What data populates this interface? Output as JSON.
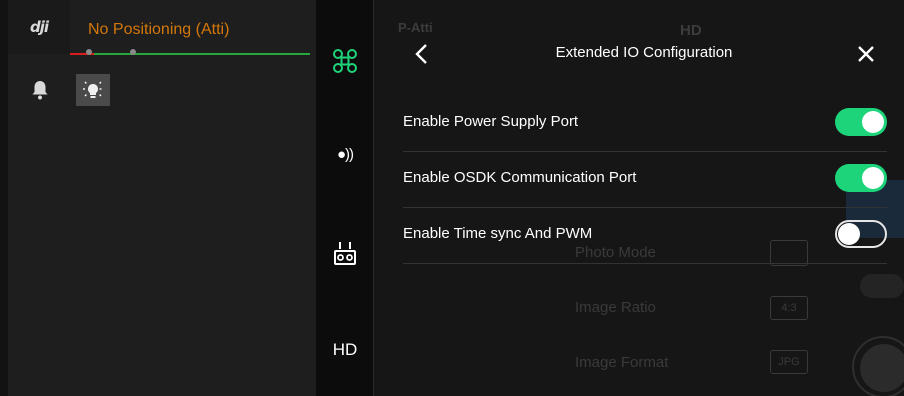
{
  "status": {
    "logo": "dji",
    "flight_mode": "No Positioning (Atti)",
    "colors": {
      "mode_text": "#d4770a",
      "line_red": "#d91e1e",
      "line_green": "#26a83b"
    }
  },
  "left_icons": [
    {
      "name": "bell-icon"
    },
    {
      "name": "auxiliary-light-icon"
    }
  ],
  "sidebar": {
    "items": [
      {
        "name": "aircraft-icon",
        "active": true
      },
      {
        "name": "signal-icon",
        "label": "●))"
      },
      {
        "name": "remote-controller-icon"
      },
      {
        "name": "hd-label",
        "label": "HD"
      }
    ],
    "colors": {
      "active": "#1ed47a"
    }
  },
  "panel": {
    "title": "Extended IO Configuration",
    "rows": [
      {
        "label": "Enable Power Supply Port",
        "enabled": true
      },
      {
        "label": "Enable OSDK Communication Port",
        "enabled": true
      },
      {
        "label": "Enable Time sync And PWM",
        "enabled": false
      }
    ],
    "colors": {
      "toggle_on": "#1ed47a"
    }
  },
  "background": {
    "top_bar": {
      "mode": "P-Atti",
      "hd": "HD"
    },
    "camera_settings": [
      {
        "label": "Photo Mode",
        "value": ""
      },
      {
        "label": "Image Ratio",
        "value": "4:3"
      },
      {
        "label": "Image Format",
        "value": "JPG"
      }
    ]
  }
}
